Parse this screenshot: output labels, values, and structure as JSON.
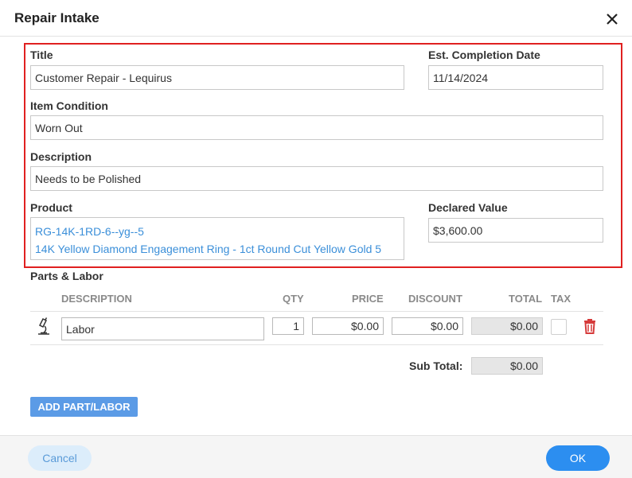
{
  "dialog": {
    "title": "Repair Intake"
  },
  "form": {
    "title_label": "Title",
    "title_value": "Customer Repair - Lequirus",
    "date_label": "Est. Completion Date",
    "date_value": "11/14/2024",
    "condition_label": "Item Condition",
    "condition_value": "Worn Out",
    "description_label": "Description",
    "description_value": "Needs to be Polished",
    "product_label": "Product",
    "product_sku": "RG-14K-1RD-6--yg--5",
    "product_name": "14K Yellow Diamond Engagement Ring - 1ct Round Cut Yellow Gold 5",
    "declared_label": "Declared Value",
    "declared_value": "$3,600.00"
  },
  "parts_labor": {
    "section_title": "Parts & Labor",
    "columns": {
      "description": "DESCRIPTION",
      "qty": "QTY",
      "price": "PRICE",
      "discount": "DISCOUNT",
      "total": "TOTAL",
      "tax": "TAX"
    },
    "rows": [
      {
        "icon": "microscope-icon",
        "description": "Labor",
        "qty": "1",
        "price": "$0.00",
        "discount": "$0.00",
        "total": "$0.00",
        "tax_checked": false
      }
    ],
    "subtotal_label": "Sub Total:",
    "subtotal_value": "$0.00",
    "add_button": "ADD PART/LABOR"
  },
  "footer": {
    "cancel_label": "Cancel",
    "ok_label": "OK"
  },
  "colors": {
    "highlight_border": "#e02020",
    "link_blue": "#3b8fd9",
    "primary_button": "#2c8ef0",
    "delete_red": "#d63b3b"
  }
}
